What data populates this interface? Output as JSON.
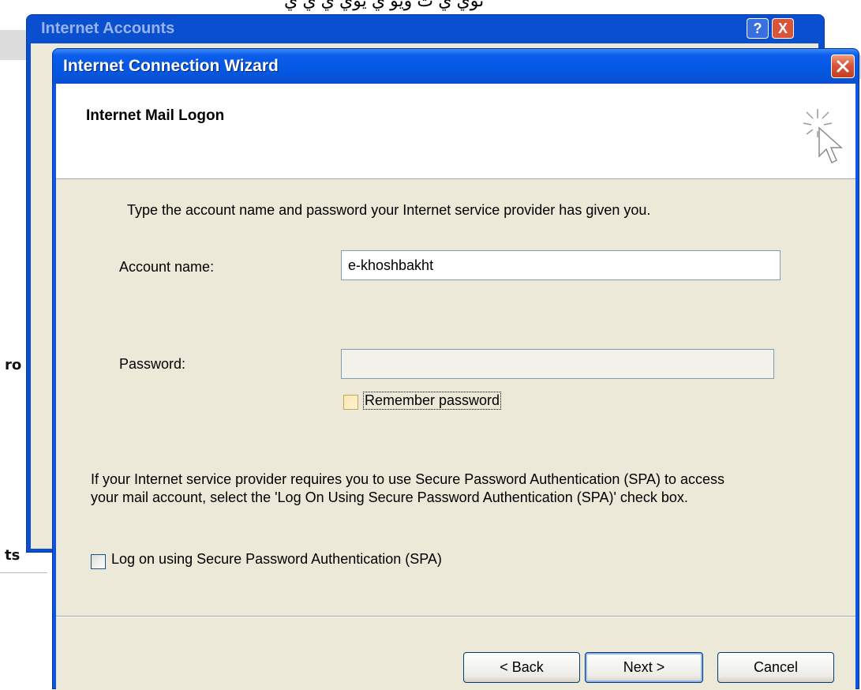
{
  "background": {
    "top_text": "ئوي ي ت ويو ي يوي ي ي ي",
    "fragment_ro": "ro",
    "fragment_ts": "ts",
    "back_window_title": "Internet Accounts",
    "back_help_label": "?",
    "back_close_label": "X"
  },
  "window": {
    "title": "Internet Connection Wizard"
  },
  "page": {
    "heading": "Internet Mail Logon",
    "instruction": "Type the account name and password your Internet service provider has given you.",
    "account_label": "Account name:",
    "account_value": "e-khoshbakht",
    "password_label": "Password:",
    "password_value": "",
    "remember_label": "Remember password",
    "remember_checked": false,
    "spa_paragraph": "If your Internet service provider requires you to use Secure Password Authentication (SPA) to access your mail account, select the 'Log On Using Secure Password Authentication (SPA)' check box.",
    "spa_label": "Log on using Secure Password Authentication (SPA)",
    "spa_checked": false
  },
  "buttons": {
    "back": "< Back",
    "next": "Next >",
    "cancel": "Cancel"
  },
  "icons": {
    "wizard": "cursor-click-icon",
    "close": "close-icon"
  }
}
